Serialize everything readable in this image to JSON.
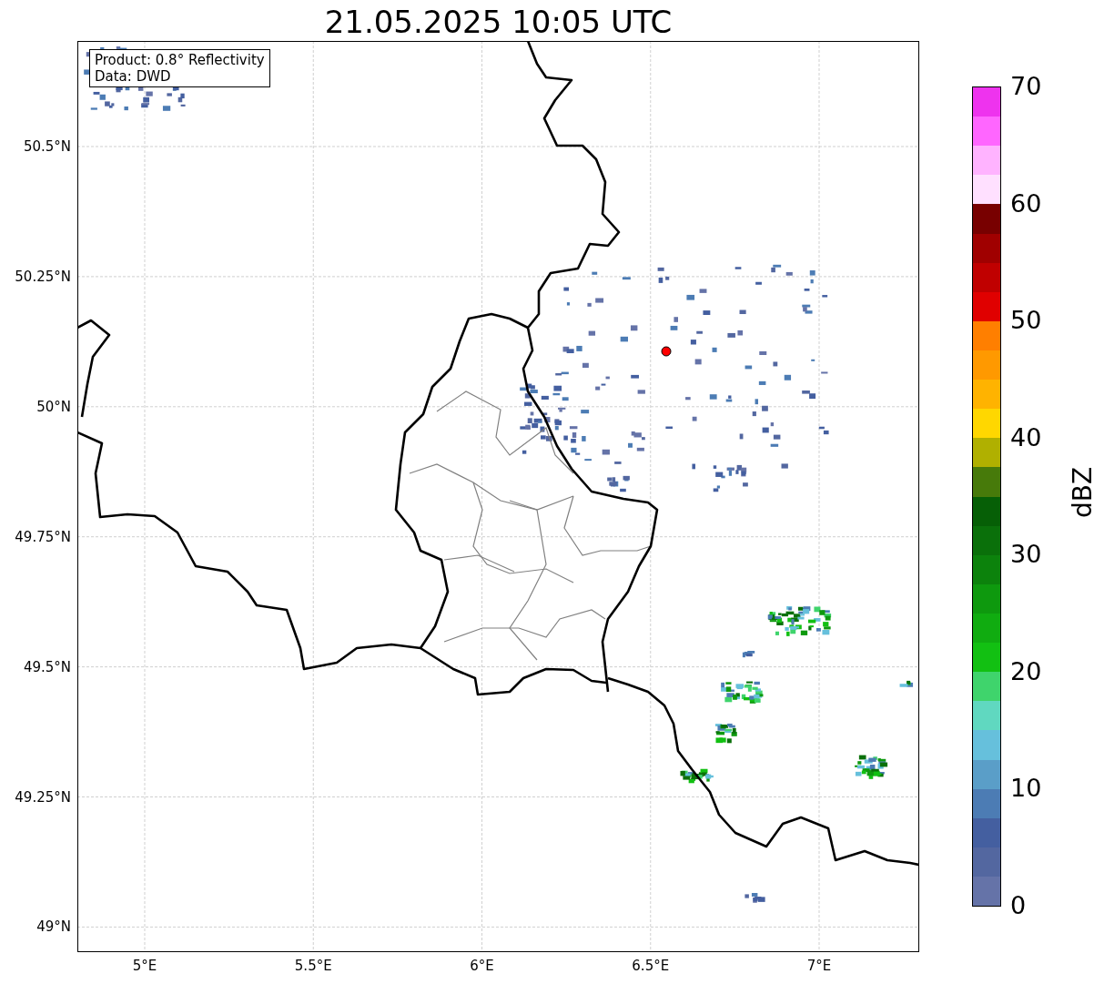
{
  "title": "21.05.2025 10:05 UTC",
  "legend": [
    "Product: 0.8° Reflectivity",
    "Data: DWD"
  ],
  "map": {
    "yticks": [
      "50.5°N",
      "50.25°N",
      "50°N",
      "49.75°N",
      "49.5°N",
      "49.25°N",
      "49°N"
    ],
    "xticks": [
      "5°E",
      "5.5°E",
      "6°E",
      "6.5°E",
      "7°E"
    ]
  },
  "colorbar": {
    "label": "dBZ",
    "ticks": [
      "70",
      "60",
      "50",
      "40",
      "30",
      "20",
      "10",
      "0"
    ],
    "segments": [
      {
        "color": "#ee33ee"
      },
      {
        "color": "#ff66ff"
      },
      {
        "color": "#ffb3ff"
      },
      {
        "color": "#ffe0ff"
      },
      {
        "color": "#780000"
      },
      {
        "color": "#a00000"
      },
      {
        "color": "#c00000"
      },
      {
        "color": "#e00000"
      },
      {
        "color": "#ff7f00"
      },
      {
        "color": "#ff9900"
      },
      {
        "color": "#ffb300"
      },
      {
        "color": "#ffd700"
      },
      {
        "color": "#b0b000"
      },
      {
        "color": "#477a0a"
      },
      {
        "color": "#065f06"
      },
      {
        "color": "#0a700a"
      },
      {
        "color": "#0c820c"
      },
      {
        "color": "#0e990e"
      },
      {
        "color": "#10ac10"
      },
      {
        "color": "#12c012"
      },
      {
        "color": "#3fd46c"
      },
      {
        "color": "#60d8c0"
      },
      {
        "color": "#66c0dc"
      },
      {
        "color": "#5a9ec8"
      },
      {
        "color": "#4c7cb4"
      },
      {
        "color": "#445fa0"
      },
      {
        "color": "#5367a0"
      },
      {
        "color": "#6573a8"
      }
    ]
  }
}
